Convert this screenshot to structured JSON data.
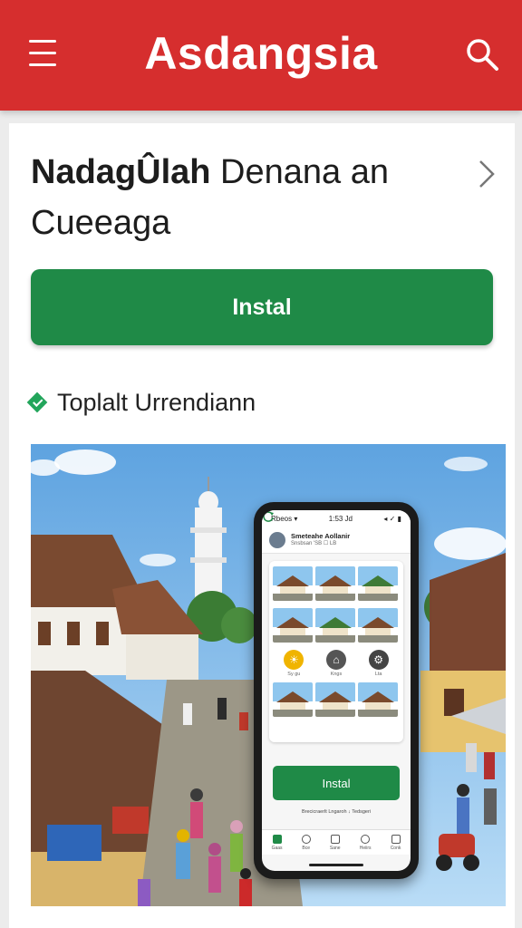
{
  "header": {
    "title": "Asdangsia",
    "menu_icon": "hamburger-menu-icon",
    "search_icon": "search-icon",
    "background_color": "#d62e2e"
  },
  "card": {
    "heading_bold": "NadagÛlah",
    "heading_rest": " Denana an Cueeaga",
    "chevron_icon": "chevron-right-icon"
  },
  "install": {
    "label": "Instal",
    "color": "#1f8a47"
  },
  "section": {
    "title": "Toplalt Urrendiann",
    "icon": "diamond-check-icon",
    "icon_color": "#22a55b"
  },
  "phone": {
    "status_left": "Rbeos ▾",
    "status_center": "1:53 Jd",
    "status_right": "◂ ✓ ▮",
    "app_title": "Smeteahe Aollanir",
    "app_subtitle": "Snsbsan 'SB ☐ LB",
    "icon_labels": [
      "Sy gu",
      "Kngs",
      "Lta"
    ],
    "install_label": "Instal",
    "footer_text": "Brecicraerlt Lngaroh ↓ Tedsgeri",
    "nav_labels": [
      "Gaas",
      "Bce",
      "Sane",
      "Heiirs",
      "Conk"
    ]
  }
}
